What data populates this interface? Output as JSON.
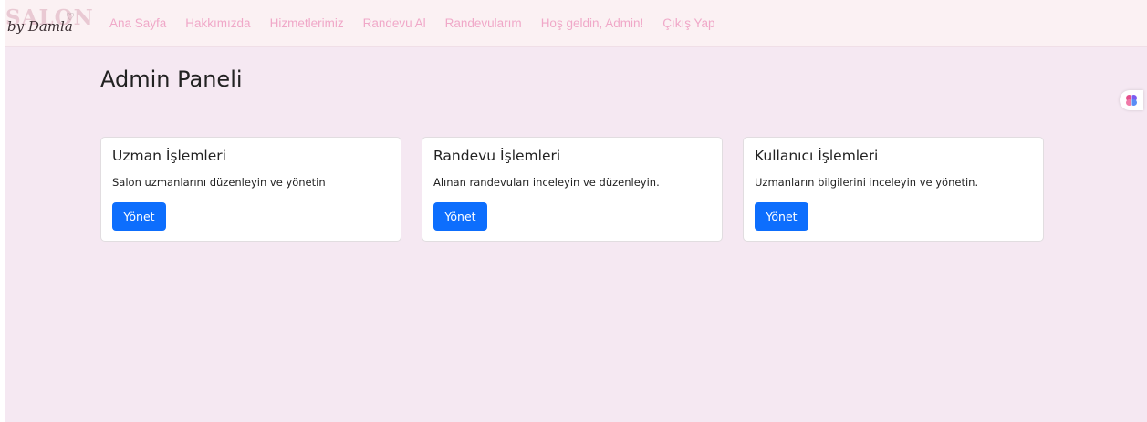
{
  "brand": {
    "logo_main": "SALON",
    "logo_script": "by Damla"
  },
  "nav": {
    "items": [
      {
        "label": "Ana Sayfa"
      },
      {
        "label": "Hakkımızda"
      },
      {
        "label": "Hizmetlerimiz"
      },
      {
        "label": "Randevu Al"
      },
      {
        "label": "Randevularım"
      },
      {
        "label": "Hoş geldin, Admin!"
      },
      {
        "label": "Çıkış Yap"
      }
    ]
  },
  "page": {
    "title": "Admin Paneli"
  },
  "cards": [
    {
      "title": "Uzman İşlemleri",
      "text": "Salon uzmanlarını düzenleyin ve yönetin",
      "button": "Yönet"
    },
    {
      "title": "Randevu İşlemleri",
      "text": "Alınan randevuları inceleyin ve düzenleyin.",
      "button": "Yönet"
    },
    {
      "title": "Kullanıcı İşlemleri",
      "text": "Uzmanların bilgilerini inceleyin ve yönetin.",
      "button": "Yönet"
    }
  ],
  "colors": {
    "background": "#f5e8f2",
    "navbar": "#fbf1f3",
    "nav_link": "#f0a8c8",
    "primary_button": "#0d6efd"
  },
  "icons": {
    "extension": "brain-icon",
    "logo_heart": "heart-icon"
  }
}
